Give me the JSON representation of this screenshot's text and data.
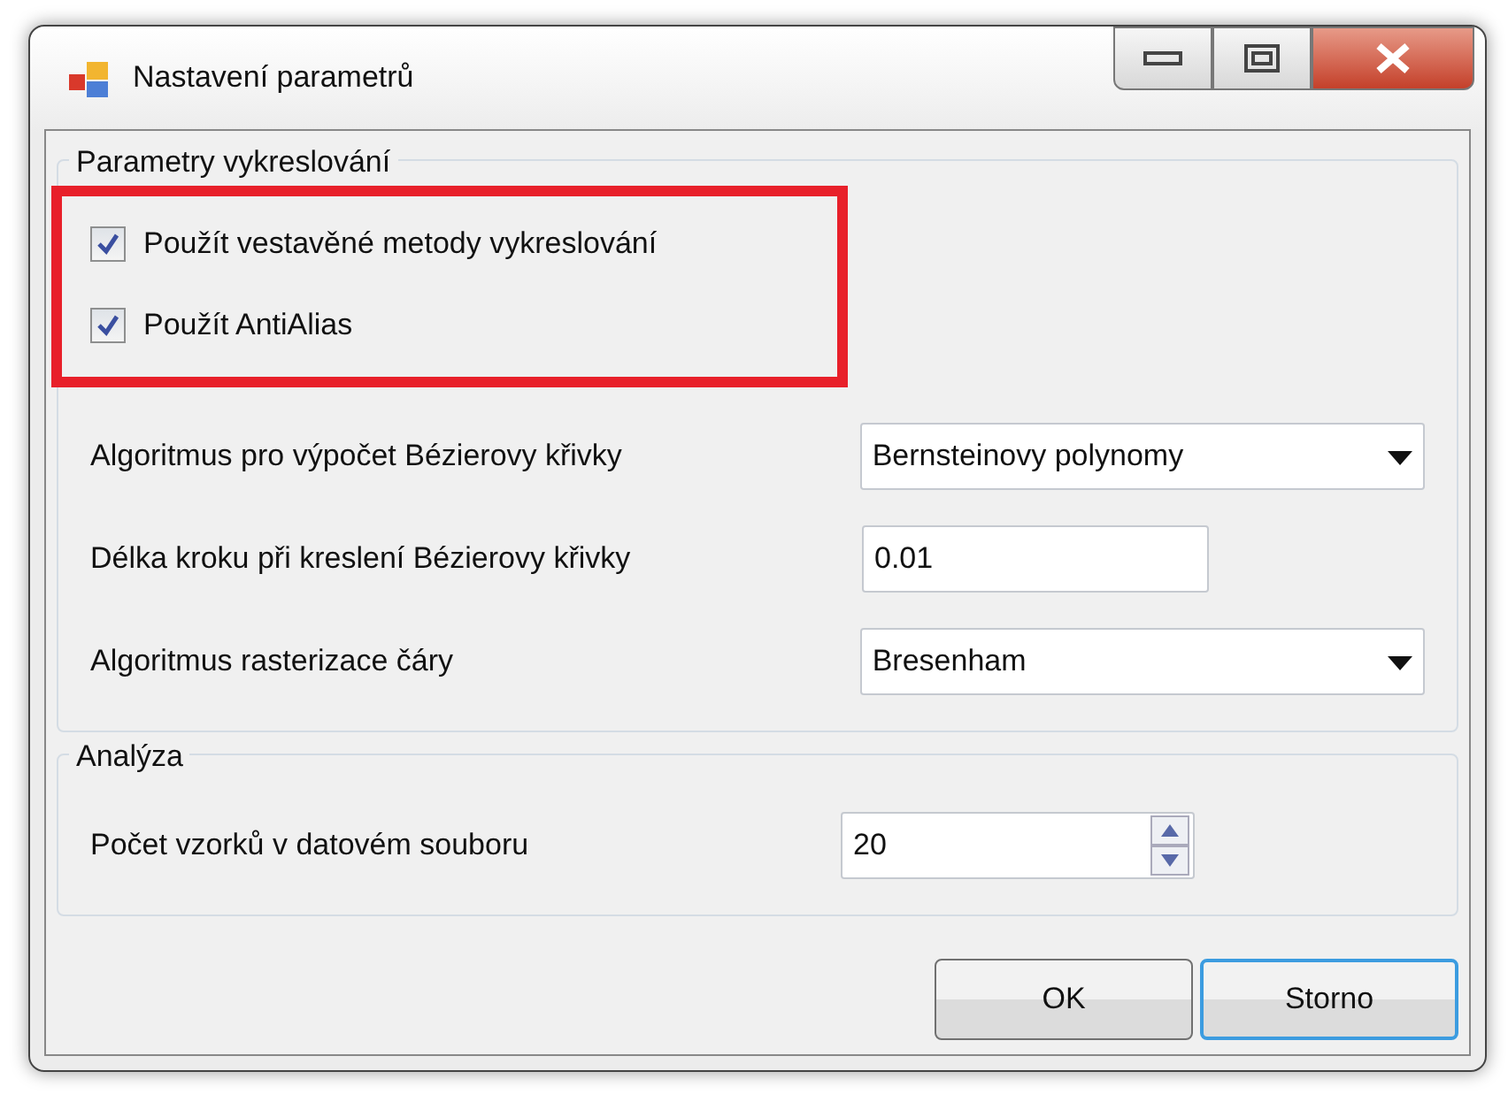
{
  "window": {
    "title": "Nastavení parametrů"
  },
  "groups": [
    {
      "title": "Parametry vykreslování",
      "checkbox_section": {
        "highlighted": true,
        "checkboxes": [
          {
            "label": "Použít vestavěné metody vykreslování",
            "checked": true
          },
          {
            "label": "Použít AntiAlias",
            "checked": true
          }
        ]
      },
      "fields": [
        {
          "kind": "select",
          "label": "Algoritmus pro výpočet Bézierovy křivky",
          "value": "Bernsteinovy polynomy"
        },
        {
          "kind": "text",
          "label": "Délka kroku při kreslení Bézierovy křivky",
          "value": "0.01"
        },
        {
          "kind": "select",
          "label": "Algoritmus rasterizace čáry",
          "value": "Bresenham"
        }
      ]
    },
    {
      "title": "Analýza",
      "fields": [
        {
          "kind": "spinner",
          "label": "Počet vzorků v datovém souboru",
          "value": "20"
        }
      ]
    }
  ],
  "buttons": [
    {
      "label": "OK",
      "focused": false
    },
    {
      "label": "Storno",
      "focused": true
    }
  ]
}
